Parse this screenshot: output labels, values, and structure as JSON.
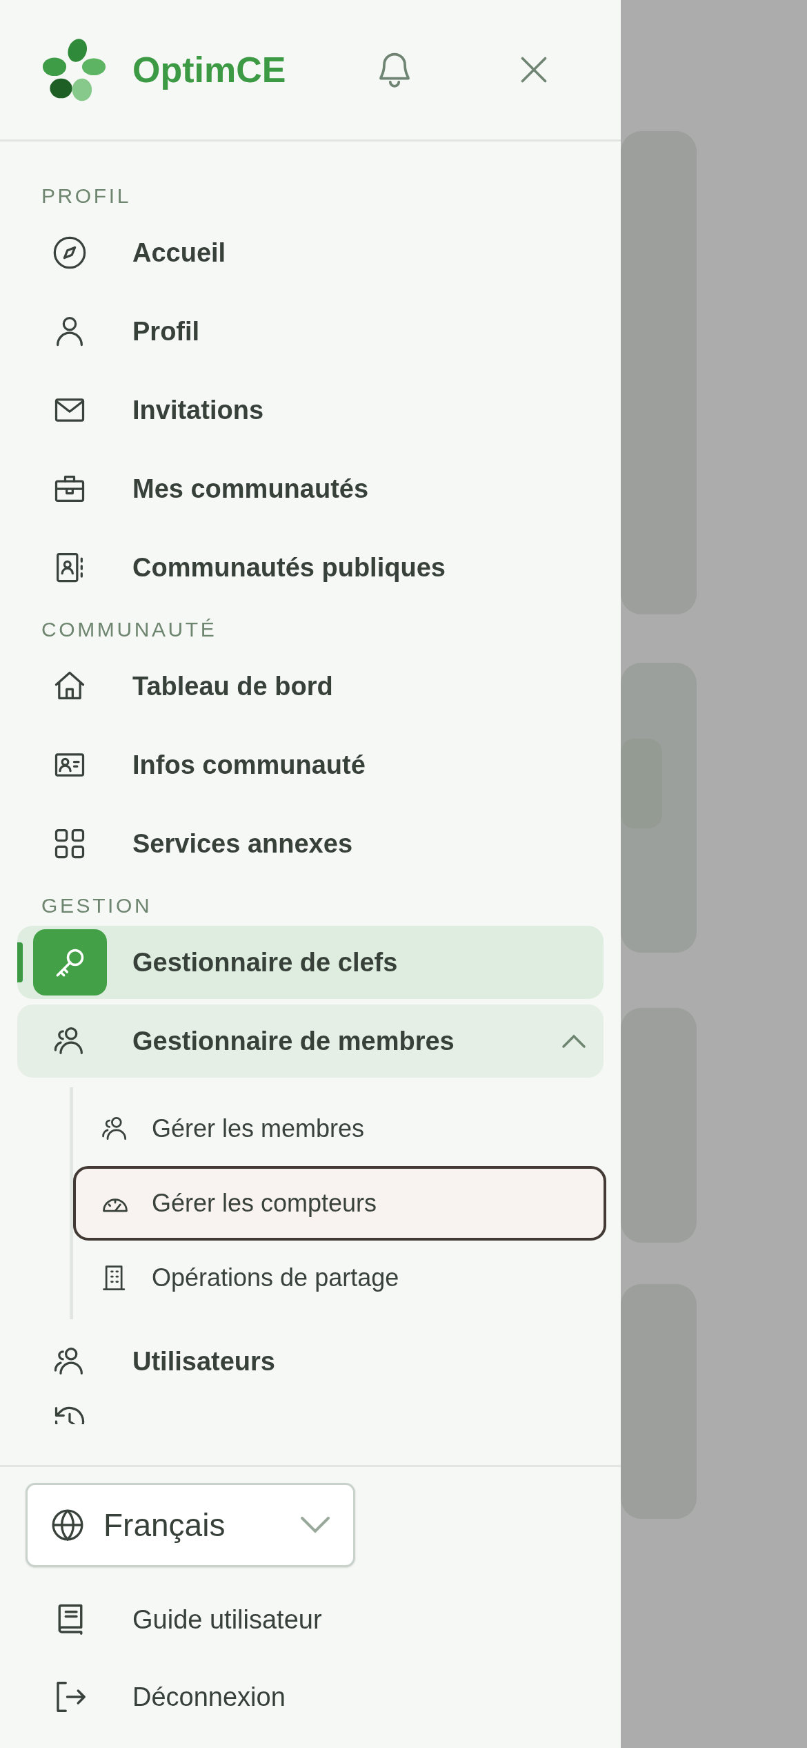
{
  "header": {
    "brand": "OptimCE"
  },
  "sections": [
    {
      "title": "PROFIL",
      "items": [
        {
          "label": "Accueil",
          "selected": false
        },
        {
          "label": "Profil",
          "selected": false
        },
        {
          "label": "Invitations",
          "selected": false
        },
        {
          "label": "Mes communautés",
          "selected": false
        },
        {
          "label": "Communautés publiques",
          "selected": false
        }
      ]
    },
    {
      "title": "COMMUNAUTÉ",
      "items": [
        {
          "label": "Tableau de bord",
          "selected": false
        },
        {
          "label": "Infos communauté",
          "selected": false
        },
        {
          "label": "Services annexes",
          "selected": false
        }
      ]
    },
    {
      "title": "GESTION",
      "items": [
        {
          "label": "Gestionnaire de clefs",
          "selected": true
        },
        {
          "label": "Gestionnaire de membres",
          "selected": false,
          "expanded": true,
          "children": [
            {
              "label": "Gérer les membres",
              "selected": false
            },
            {
              "label": "Gérer les compteurs",
              "selected": true
            },
            {
              "label": "Opérations de partage",
              "selected": false
            }
          ]
        },
        {
          "label": "Utilisateurs",
          "selected": false
        },
        {
          "kind": "clipped"
        }
      ]
    }
  ],
  "language": {
    "value": "Français"
  },
  "footer_items": [
    {
      "label": "Guide utilisateur"
    },
    {
      "label": "Déconnexion"
    }
  ]
}
